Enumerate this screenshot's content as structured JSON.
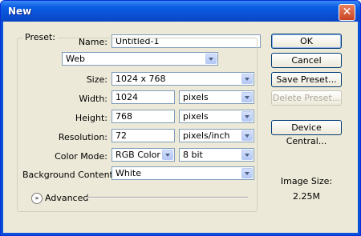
{
  "window": {
    "title": "New",
    "close_glyph": "✕"
  },
  "name": {
    "label": "Name:",
    "value": "Untitled-1"
  },
  "preset": {
    "label": "Preset:",
    "value": "Web"
  },
  "size": {
    "label": "Size:",
    "value": "1024 x 768"
  },
  "width": {
    "label": "Width:",
    "value": "1024",
    "unit": "pixels"
  },
  "height": {
    "label": "Height:",
    "value": "768",
    "unit": "pixels"
  },
  "resolution": {
    "label": "Resolution:",
    "value": "72",
    "unit": "pixels/inch"
  },
  "color_mode": {
    "label": "Color Mode:",
    "value": "RGB Color",
    "depth": "8 bit"
  },
  "background": {
    "label": "Background Contents:",
    "value": "White"
  },
  "advanced": {
    "label": "Advanced",
    "icon": "chevron-double-down-icon",
    "glyph": "»"
  },
  "buttons": {
    "ok": "OK",
    "cancel": "Cancel",
    "save_preset": "Save Preset...",
    "delete_preset": "Delete Preset...",
    "device_central": "Device Central..."
  },
  "image_size": {
    "label": "Image Size:",
    "value": "2.25M"
  },
  "colors": {
    "titlebar": "#0a4fd3",
    "dialog_bg": "#ece9d8"
  }
}
